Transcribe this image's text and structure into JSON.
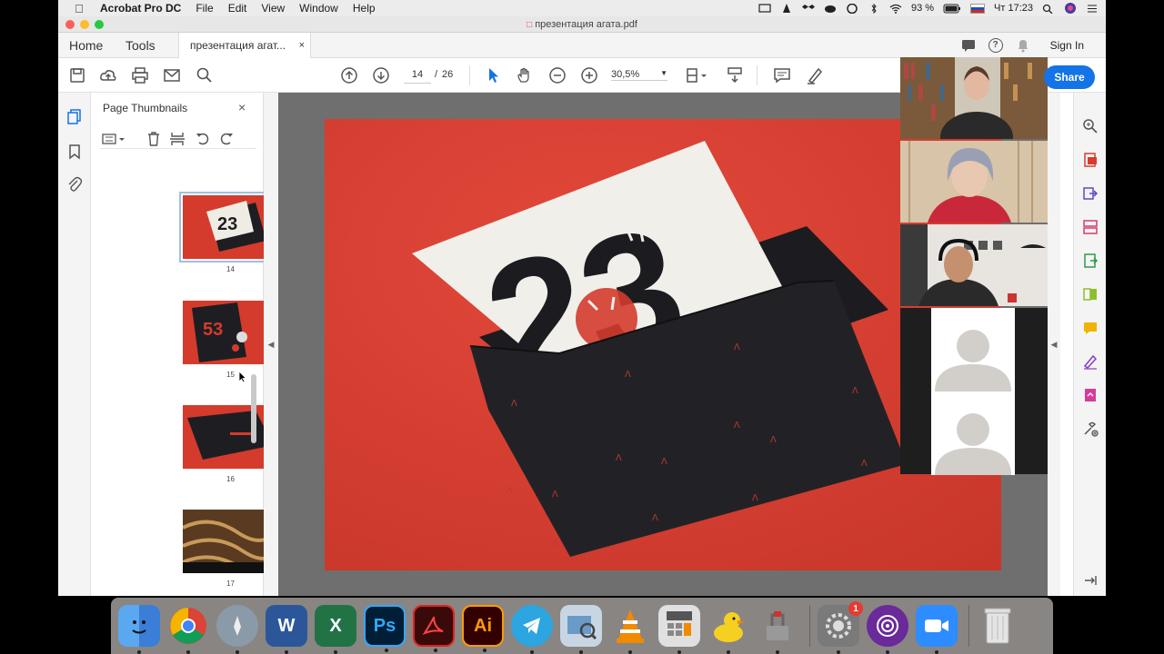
{
  "menubar": {
    "app_name": "Acrobat Pro DC",
    "items": [
      "File",
      "Edit",
      "View",
      "Window",
      "Help"
    ],
    "battery": "93 %",
    "clock": "Чт 17:23"
  },
  "window": {
    "title": "презентация агата.pdf"
  },
  "tabs": {
    "home": "Home",
    "tools": "Tools",
    "doc": "презентация агат...",
    "doc_close": "×",
    "sign_in": "Sign In",
    "help_glyph": "?"
  },
  "toolbar": {
    "page_current": "14",
    "page_sep": "/",
    "page_total": "26",
    "zoom": "30,5%",
    "share": "Share"
  },
  "thumbnails": {
    "title": "Page Thumbnails",
    "close": "×",
    "pages": [
      {
        "label": "14"
      },
      {
        "label": "15"
      },
      {
        "label": "16"
      },
      {
        "label": "17"
      }
    ]
  },
  "page_art": {
    "numeral": "23"
  },
  "colors": {
    "accent": "#1473e6",
    "page_red": "#d9402f",
    "envelope": "#222226",
    "card": "#f1efe9"
  },
  "dock": {
    "items": [
      "Finder",
      "Chrome",
      "Launchpad",
      "Word",
      "Excel",
      "Photoshop",
      "Acrobat",
      "Illustrator",
      "Telegram",
      "Preview",
      "VLC",
      "Calculator",
      "Cyberduck",
      "Migration",
      "System Preferences",
      "Tor",
      "Zoom",
      "Trash"
    ],
    "sysprefs_badge": "1"
  }
}
